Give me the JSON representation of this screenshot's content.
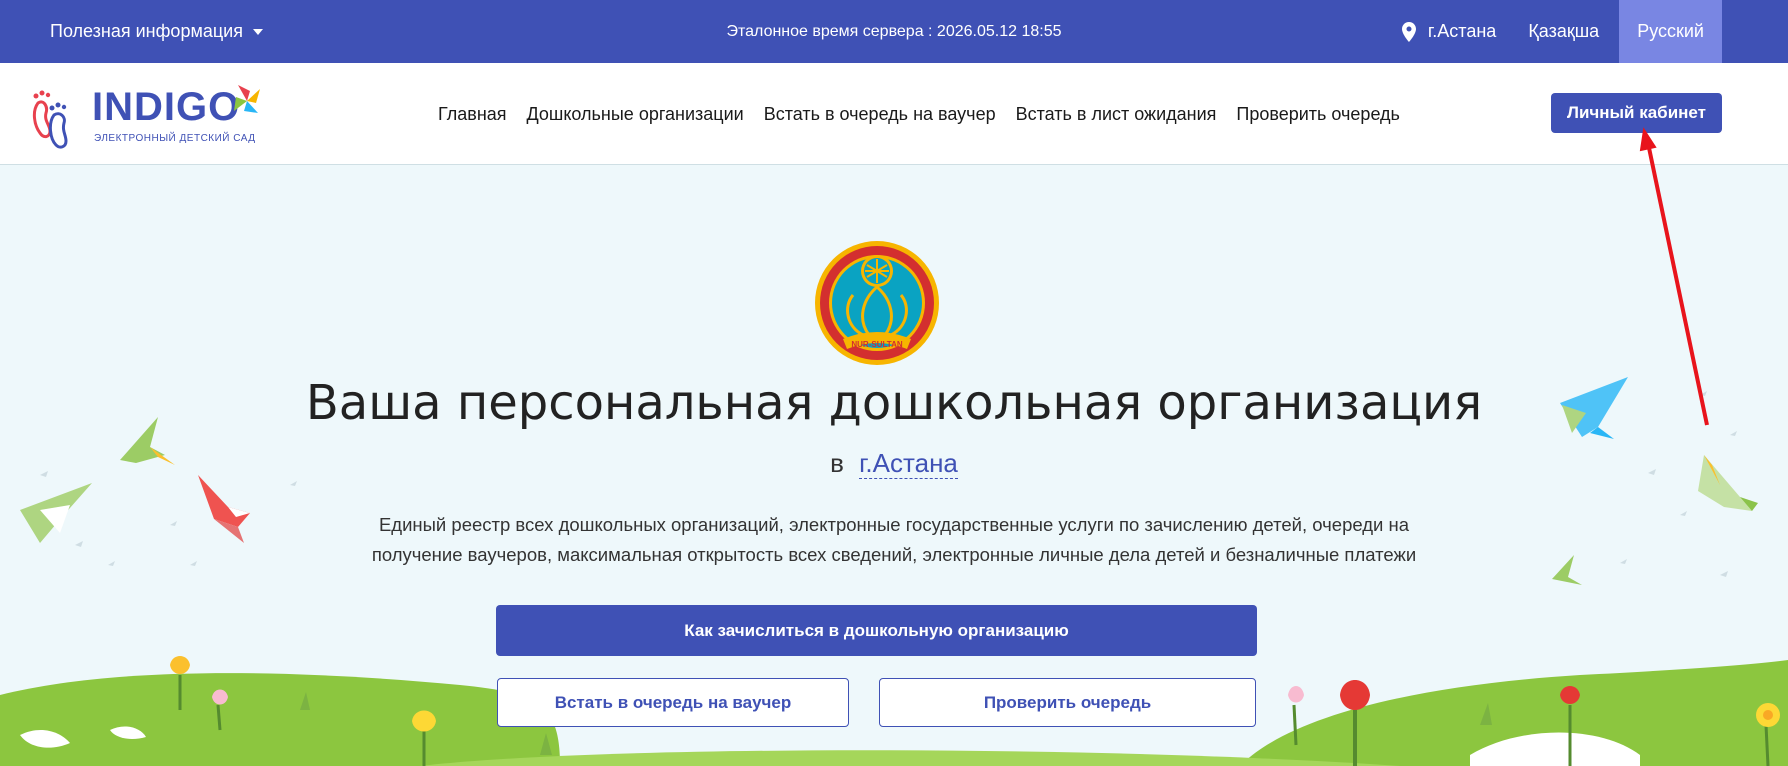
{
  "topbar": {
    "info_label": "Полезная информация",
    "server_time": "Эталонное время сервера : 2026.05.12 18:55",
    "city": "г.Астана",
    "lang_kz": "Қазақша",
    "lang_ru": "Русский"
  },
  "navbar": {
    "logo_brand": "INDIGO",
    "logo_sub": "ЭЛЕКТРОННЫЙ ДЕТСКИЙ САД",
    "menu": [
      "Главная",
      "Дошкольные организации",
      "Встать в очередь на ваучер",
      "Встать в лист ожидания",
      "Проверить очередь"
    ],
    "cabinet_button": "Личный кабинет"
  },
  "hero": {
    "emblem_text": "NUR-SULTAN",
    "title": "Ваша персональная дошкольная организация",
    "city_prefix": "в",
    "city_link": "г.Астана",
    "description_line1": "Единый реестр всех дошкольных организаций, электронные государственные услуги по зачислению детей, очереди на",
    "description_line2": "получение ваучеров, максимальная открытость всех сведений, электронные личные дела детей и безналичные платежи",
    "primary_button": "Как зачислиться в дошкольную организацию",
    "voucher_button": "Встать в очередь на ваучер",
    "check_button": "Проверить очередь"
  },
  "colors": {
    "primary": "#3f51b5",
    "primary_active": "#7986e3",
    "hero_bg": "#eef8fb",
    "grass": "#8cc63f",
    "annotation_arrow": "#e8141c"
  },
  "icons": {
    "location": "location-pin-icon",
    "dropdown": "caret-down-icon"
  }
}
